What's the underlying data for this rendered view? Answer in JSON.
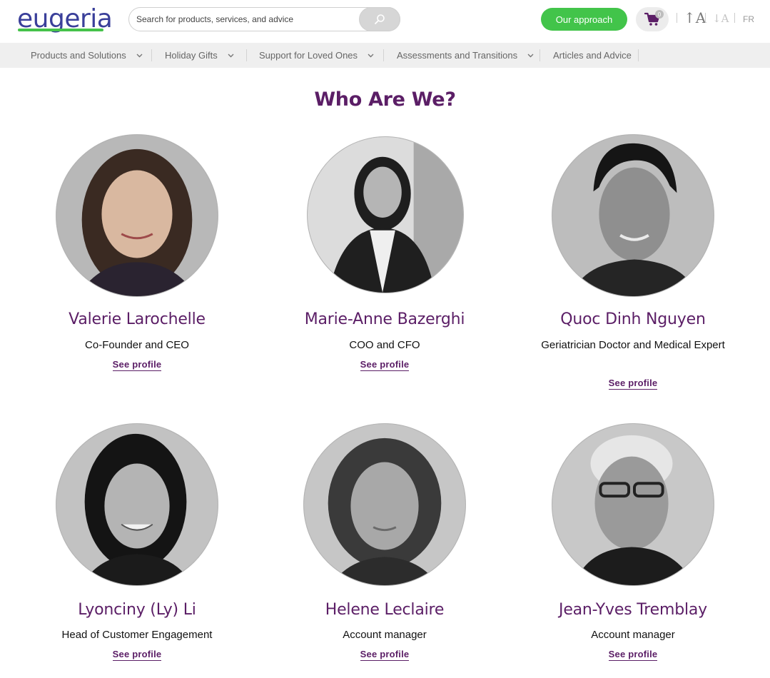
{
  "header": {
    "logo_text": "eugeria",
    "search_placeholder": "Search for products, services, and advice",
    "approach_button": "Our approach",
    "cart_count": "0",
    "font_increase": "↑A",
    "font_decrease": "↓A",
    "language": "FR"
  },
  "nav": {
    "items": [
      {
        "label": "Products and Solutions",
        "has_dropdown": true
      },
      {
        "label": "Holiday Gifts",
        "has_dropdown": true
      },
      {
        "label": "Support for Loved Ones",
        "has_dropdown": true
      },
      {
        "label": "Assessments and Transitions",
        "has_dropdown": true
      },
      {
        "label": "Articles and Advice",
        "has_dropdown": false
      }
    ]
  },
  "section": {
    "title": "Who Are We?"
  },
  "team": [
    {
      "name": "Valerie Larochelle",
      "role": "Co-Founder and CEO",
      "link": "See profile"
    },
    {
      "name": "Marie-Anne Bazerghi",
      "role": "COO and CFO",
      "link": "See profile"
    },
    {
      "name": "Quoc Dinh Nguyen",
      "role": "Geriatrician Doctor and Medical Expert",
      "link": "See profile"
    },
    {
      "name": "Lyonciny (Ly) Li",
      "role": "Head of Customer Engagement",
      "link": "See profile"
    },
    {
      "name": "Helene Leclaire",
      "role": "Account manager",
      "link": "See profile"
    },
    {
      "name": "Jean-Yves Tremblay",
      "role": "Account manager",
      "link": "See profile"
    }
  ],
  "colors": {
    "brand_purple": "#5b1e66",
    "brand_green": "#42c44a",
    "logo_blue": "#3a3f9a"
  }
}
